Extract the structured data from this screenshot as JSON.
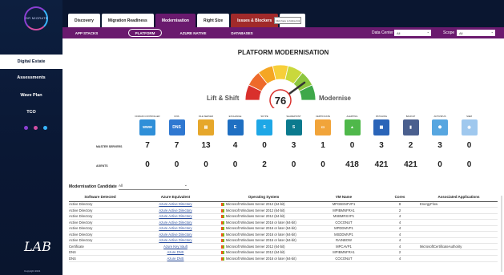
{
  "brand": {
    "logo_text": "DR MIGRATE",
    "footer_logo": "LAB",
    "copyright": "Copyright 2021"
  },
  "sidebar": {
    "items": [
      {
        "label": "Digital Estate",
        "active": true
      },
      {
        "label": "Assessments",
        "active": false
      },
      {
        "label": "Wave Plan",
        "active": false
      },
      {
        "label": "TCO",
        "active": false
      }
    ],
    "dot_colors": [
      "#8a3fd1",
      "#d14fa3",
      "#38b6ff"
    ]
  },
  "tabs": [
    {
      "label": "Discovery",
      "style": "plain"
    },
    {
      "label": "Migration Readiness",
      "style": "plain"
    },
    {
      "label": "Modernisation",
      "style": "active"
    },
    {
      "label": "Right Size",
      "style": "plain"
    },
    {
      "label": "Issues & Blockers",
      "style": "red"
    },
    {
      "label": "Data C",
      "style": "plain"
    }
  ],
  "tooltip": "Click here to follow link",
  "subnav": {
    "items": [
      {
        "label": "APP STACKS",
        "active": false
      },
      {
        "label": "PLATFORM",
        "active": true
      },
      {
        "label": "AZURE NATIVE",
        "active": false
      },
      {
        "label": "DATABASES",
        "active": false
      }
    ],
    "data_center_label": "Data Center",
    "data_center_value": "All",
    "scope_label": "Scope",
    "scope_value": "All"
  },
  "page": {
    "title": "PLATFORM MODERNISATION",
    "left_label": "Lift & Shift",
    "right_label": "Modernise",
    "score": "76"
  },
  "gauge_colors": [
    "#d9302c",
    "#ee6a2a",
    "#f5a623",
    "#f7cf3a",
    "#c9d83c",
    "#8cc63f",
    "#3ea84a"
  ],
  "services": [
    {
      "label": "DOMAIN CONTROLLER",
      "icon": "www-icon",
      "glyph": "www",
      "color": "#2f8fd8",
      "master": "7",
      "agents": "0"
    },
    {
      "label": "DNS",
      "icon": "dns-icon",
      "glyph": "DNS",
      "color": "#2f78d1",
      "master": "7",
      "agents": "0"
    },
    {
      "label": "FILE SERVER",
      "icon": "file-server-icon",
      "glyph": "▤",
      "color": "#e6a72b",
      "master": "13",
      "agents": "0"
    },
    {
      "label": "EXCHANGE",
      "icon": "exchange-icon",
      "glyph": "E",
      "color": "#1f6fc2",
      "master": "4",
      "agents": "0"
    },
    {
      "label": "SKYPE",
      "icon": "skype-icon",
      "glyph": "S",
      "color": "#1ea7e6",
      "master": "0",
      "agents": "2"
    },
    {
      "label": "SHAREPOINT",
      "icon": "sharepoint-icon",
      "glyph": "S",
      "color": "#0b7a8e",
      "master": "3",
      "agents": "0"
    },
    {
      "label": "CERTIFICATE",
      "icon": "certificate-icon",
      "glyph": "▭",
      "color": "#f1a43a",
      "master": "1",
      "agents": "0"
    },
    {
      "label": "ALERTING",
      "icon": "alerting-icon",
      "glyph": "▲",
      "color": "#4fb84a",
      "master": "0",
      "agents": "418"
    },
    {
      "label": "PATCHING",
      "icon": "patching-icon",
      "glyph": "▦",
      "color": "#2a64b8",
      "master": "3",
      "agents": "421"
    },
    {
      "label": "BACKUP",
      "icon": "backup-icon",
      "glyph": "▮",
      "color": "#4a5f8e",
      "master": "2",
      "agents": "421"
    },
    {
      "label": "ANTIVIRUS",
      "icon": "antivirus-icon",
      "glyph": "⬢",
      "color": "#57a6e0",
      "master": "3",
      "agents": "0"
    },
    {
      "label": "SIEM",
      "icon": "siem-icon",
      "glyph": "◉",
      "color": "#9fc8ee",
      "master": "0",
      "agents": "0"
    }
  ],
  "row_labels": {
    "master": "MASTER SERVERS",
    "agents": "AGENTS"
  },
  "candidate": {
    "label": "Modernisation Candidate",
    "value": "All"
  },
  "table": {
    "headers": [
      "Software Detected",
      "Azure Equivalent",
      "Operating System",
      "VM Name",
      "Cores",
      "Associated Applications"
    ],
    "rows": [
      [
        "Active Directory",
        "Azure Active Directory",
        "Microsoft Windows Server 2012 (64-bit)",
        "MPGBSNFVP1",
        "8",
        "EnergyFlow"
      ],
      [
        "Active Directory",
        "Azure Active Directory",
        "Microsoft Windows Server 2012 (64-bit)",
        "MPIBMNFRA1",
        "2",
        ""
      ],
      [
        "Active Directory",
        "Azure Active Directory",
        "Microsoft Windows Server 2012 (64-bit)",
        "MSBMRSVP1",
        "4",
        ""
      ],
      [
        "Active Directory",
        "Azure Active Directory",
        "Microsoft Windows Server 2016 or later (64-bit)",
        "COCONUT",
        "4",
        ""
      ],
      [
        "Active Directory",
        "Azure Active Directory",
        "Microsoft Windows Server 2016 or later (64-bit)",
        "MPDDMVP1",
        "4",
        ""
      ],
      [
        "Active Directory",
        "Azure Active Directory",
        "Microsoft Windows Server 2016 or later (64-bit)",
        "MSDDMVP1",
        "4",
        ""
      ],
      [
        "Active Directory",
        "Azure Active Directory",
        "Microsoft Windows Server 2016 or later (64-bit)",
        "RAINBOW",
        "4",
        ""
      ],
      [
        "Certificate",
        "Azure Key Vault",
        "Microsoft Windows Server 2012 (64-bit)",
        "MPCAVP1",
        "4",
        "MicrosoftCertificateAuthority"
      ],
      [
        "DNS",
        "Azure DNS",
        "Microsoft Windows Server 2012 (64-bit)",
        "MPIBMNFRA1",
        "2",
        ""
      ],
      [
        "DNS",
        "Azure DNS",
        "Microsoft Windows Server 2016 or later (64-bit)",
        "COCONUT",
        "4",
        ""
      ]
    ]
  }
}
